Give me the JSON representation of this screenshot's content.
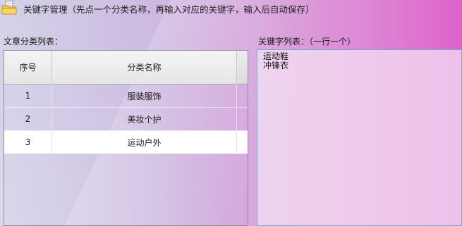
{
  "window": {
    "title": "关键字管理（先点一个分类名称，再输入对应的关键字，输入后自动保存）",
    "icon": "folder-note-icon"
  },
  "category_panel": {
    "label": "文章分类列表：",
    "columns": [
      "序号",
      "分类名称"
    ],
    "rows": [
      {
        "seq": "1",
        "name": "服装服饰",
        "selected": false
      },
      {
        "seq": "2",
        "name": "美妆个护",
        "selected": false
      },
      {
        "seq": "3",
        "name": "运动户外",
        "selected": true
      }
    ]
  },
  "keyword_panel": {
    "label": "关键字列表：（一行一个）",
    "value": "运动鞋\n冲锋衣"
  },
  "colors": {
    "accent_border": "#78a9d8",
    "selected_row": "#ffffff"
  }
}
